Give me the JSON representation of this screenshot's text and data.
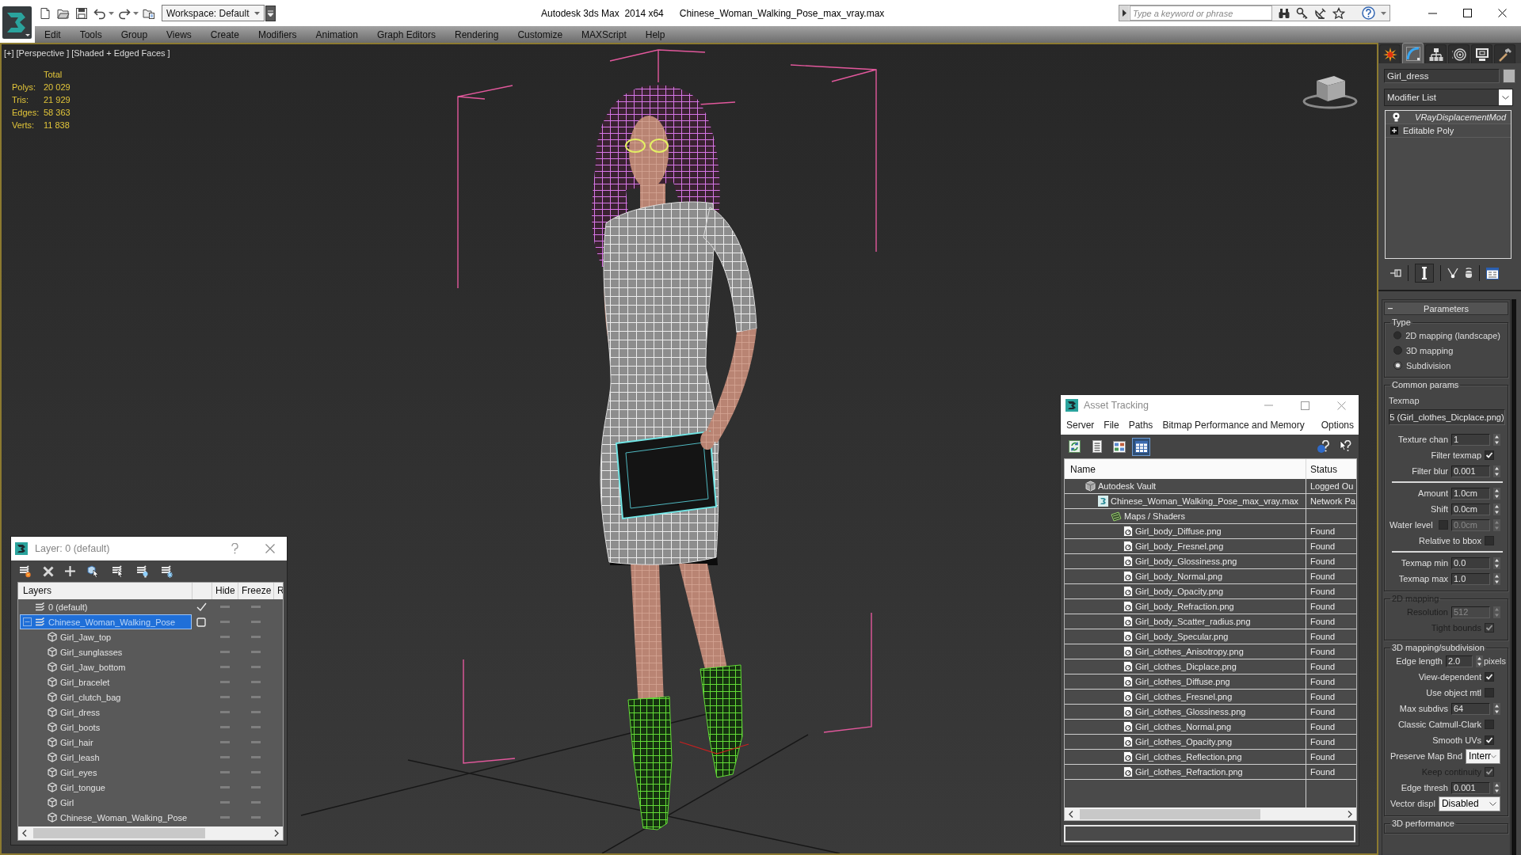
{
  "title_bar": {
    "workspace": "Workspace: Default",
    "app_title": "Autodesk 3ds Max  2014 x64",
    "file_title": "Chinese_Woman_Walking_Pose_max_vray.max",
    "search_placeholder": "Type a keyword or phrase"
  },
  "menu_bar": [
    "Edit",
    "Tools",
    "Group",
    "Views",
    "Create",
    "Modifiers",
    "Animation",
    "Graph Editors",
    "Rendering",
    "Customize",
    "MAXScript",
    "Help"
  ],
  "viewport": {
    "labels": [
      "[+]",
      "[Perspective ]",
      "[Shaded + Edged Faces ]"
    ],
    "stats": {
      "heading": "Total",
      "rows": [
        {
          "label": "Polys:",
          "value": "20 029"
        },
        {
          "label": "Tris:",
          "value": "21 929"
        },
        {
          "label": "Edges:",
          "value": "58 363"
        },
        {
          "label": "Verts:",
          "value": "11 838"
        }
      ]
    }
  },
  "layer_window": {
    "title": "Layer: 0 (default)",
    "columns": [
      "Layers",
      "Hide",
      "Freeze",
      "R"
    ],
    "layers": [
      {
        "name": "0 (default)",
        "current": true,
        "selected": false
      },
      {
        "name": "Chinese_Woman_Walking_Pose",
        "current": false,
        "selected": true,
        "expanded": true,
        "children": [
          {
            "name": "Girl_Jaw_top",
            "selected": false
          },
          {
            "name": "Girl_sunglasses",
            "selected": false
          },
          {
            "name": "Girl_Jaw_bottom",
            "selected": false
          },
          {
            "name": "Girl_bracelet",
            "selected": false
          },
          {
            "name": "Girl_clutch_bag",
            "selected": false
          },
          {
            "name": "Girl_dress",
            "selected": false
          },
          {
            "name": "Girl_boots",
            "selected": false
          },
          {
            "name": "Girl_hair",
            "selected": false
          },
          {
            "name": "Girl_leash",
            "selected": false
          },
          {
            "name": "Girl_eyes",
            "selected": false
          },
          {
            "name": "Girl_tongue",
            "selected": false
          },
          {
            "name": "Girl",
            "selected": false
          },
          {
            "name": "Chinese_Woman_Walking_Pose",
            "selected": false
          }
        ]
      }
    ]
  },
  "asset_tracking": {
    "title": "Asset Tracking",
    "menu": [
      "Server",
      "File",
      "Paths",
      "Bitmap Performance and Memory",
      "Options"
    ],
    "toolbar": [
      {
        "kind": "refresh",
        "selected": false
      },
      {
        "kind": "list",
        "selected": false
      },
      {
        "kind": "thumbnails",
        "selected": false
      },
      {
        "kind": "table",
        "selected": true
      }
    ],
    "columns": [
      "Name",
      "Status"
    ],
    "tree": [
      {
        "kind": "vault",
        "name": "Autodesk Vault",
        "status": "Logged Ou",
        "children": [
          {
            "kind": "scene",
            "name": "Chinese_Woman_Walking_Pose_max_vray.max",
            "status": "Network Pa",
            "children": [
              {
                "kind": "folder",
                "name": "Maps / Shaders",
                "children": [
                  {
                    "kind": "bitmap",
                    "name": "Girl_body_Diffuse.png",
                    "status": "Found"
                  },
                  {
                    "kind": "bitmap",
                    "name": "Girl_body_Fresnel.png",
                    "status": "Found"
                  },
                  {
                    "kind": "bitmap",
                    "name": "Girl_body_Glossiness.png",
                    "status": "Found"
                  },
                  {
                    "kind": "bitmap",
                    "name": "Girl_body_Normal.png",
                    "status": "Found"
                  },
                  {
                    "kind": "bitmap",
                    "name": "Girl_body_Opacity.png",
                    "status": "Found"
                  },
                  {
                    "kind": "bitmap",
                    "name": "Girl_body_Refraction.png",
                    "status": "Found"
                  },
                  {
                    "kind": "bitmap",
                    "name": "Girl_body_Scatter_radius.png",
                    "status": "Found"
                  },
                  {
                    "kind": "bitmap",
                    "name": "Girl_body_Specular.png",
                    "status": "Found"
                  },
                  {
                    "kind": "bitmap",
                    "name": "Girl_clothes_Anisotropy.png",
                    "status": "Found"
                  },
                  {
                    "kind": "bitmap",
                    "name": "Girl_clothes_Dicplace.png",
                    "status": "Found"
                  },
                  {
                    "kind": "bitmap",
                    "name": "Girl_clothes_Diffuse.png",
                    "status": "Found"
                  },
                  {
                    "kind": "bitmap",
                    "name": "Girl_clothes_Fresnel.png",
                    "status": "Found"
                  },
                  {
                    "kind": "bitmap",
                    "name": "Girl_clothes_Glossiness.png",
                    "status": "Found"
                  },
                  {
                    "kind": "bitmap",
                    "name": "Girl_clothes_Normal.png",
                    "status": "Found"
                  },
                  {
                    "kind": "bitmap",
                    "name": "Girl_clothes_Opacity.png",
                    "status": "Found"
                  },
                  {
                    "kind": "bitmap",
                    "name": "Girl_clothes_Reflection.png",
                    "status": "Found"
                  },
                  {
                    "kind": "bitmap",
                    "name": "Girl_clothes_Refraction.png",
                    "status": "Found"
                  }
                ]
              }
            ]
          }
        ]
      }
    ]
  },
  "command_panel": {
    "tabs": [
      {
        "kind": "create",
        "selected": false
      },
      {
        "kind": "modify",
        "selected": true
      },
      {
        "kind": "hierarchy",
        "selected": false
      },
      {
        "kind": "motion",
        "selected": false
      },
      {
        "kind": "display",
        "selected": false
      },
      {
        "kind": "utilities",
        "selected": false
      }
    ],
    "object_name": "Girl_dress",
    "modifier_list": "Modifier List",
    "stack": [
      {
        "kind": "modifier",
        "name": "VRayDisplacementMod"
      },
      {
        "kind": "base",
        "name": "Editable Poly"
      }
    ],
    "rollout": {
      "title": "Parameters",
      "groups": [
        {
          "title": "Type",
          "disabled": false,
          "rows": [
            {
              "kind": "radio",
              "label": "2D mapping (landscape)",
              "selected": false
            },
            {
              "kind": "radio",
              "label": "3D mapping",
              "selected": false
            },
            {
              "kind": "radio",
              "label": "Subdivision",
              "selected": true
            }
          ]
        },
        {
          "title": "Common params",
          "disabled": false,
          "rows": [
            {
              "kind": "label",
              "label": "Texmap"
            },
            {
              "kind": "map_button",
              "value": "5 (Girl_clothes_Dicplace.png)"
            },
            {
              "kind": "spinner",
              "label": "Texture chan",
              "value": "1",
              "disabled": false
            },
            {
              "kind": "checkbox",
              "label": "Filter texmap",
              "checked": true,
              "disabled": false
            },
            {
              "kind": "spinner",
              "label": "Filter blur",
              "value": "0.001",
              "disabled": false
            },
            {
              "kind": "separator"
            },
            {
              "kind": "spinner",
              "label": "Amount",
              "value": "1.0cm",
              "disabled": false
            },
            {
              "kind": "spinner",
              "label": "Shift",
              "value": "0.0cm",
              "disabled": false
            },
            {
              "kind": "check_spinner",
              "label": "Water level",
              "checked": false,
              "value": "0.0cm",
              "disabled": true
            },
            {
              "kind": "checkbox",
              "label": "Relative to bbox",
              "checked": false,
              "disabled": false
            },
            {
              "kind": "separator"
            },
            {
              "kind": "spinner",
              "label": "Texmap min",
              "value": "0.0",
              "disabled": false
            },
            {
              "kind": "spinner",
              "label": "Texmap max",
              "value": "1.0",
              "disabled": false
            }
          ]
        },
        {
          "title": "2D mapping",
          "disabled": true,
          "rows": [
            {
              "kind": "spinner",
              "label": "Resolution",
              "value": "512",
              "disabled": true
            },
            {
              "kind": "checkbox",
              "label": "Tight bounds",
              "checked": true,
              "disabled": true
            }
          ]
        },
        {
          "title": "3D mapping/subdivision",
          "disabled": false,
          "rows": [
            {
              "kind": "spinner",
              "label": "Edge length",
              "value": "2.0",
              "unit": "pixels",
              "disabled": false
            },
            {
              "kind": "checkbox",
              "label": "View-dependent",
              "checked": true,
              "disabled": false
            },
            {
              "kind": "checkbox",
              "label": "Use object mtl",
              "checked": false,
              "disabled": false
            },
            {
              "kind": "spinner",
              "label": "Max subdivs",
              "value": "64",
              "disabled": false
            },
            {
              "kind": "checkbox",
              "label": "Classic Catmull-Clark",
              "checked": false,
              "disabled": false
            },
            {
              "kind": "checkbox",
              "label": "Smooth UVs",
              "checked": true,
              "disabled": false
            },
            {
              "kind": "dropdown",
              "label": "Preserve Map Bnd",
              "value": "Interr",
              "disabled": false
            },
            {
              "kind": "checkbox",
              "label": "Keep continuity",
              "checked": true,
              "disabled": true
            },
            {
              "kind": "spinner",
              "label": "Edge thresh",
              "value": "0.001",
              "disabled": false
            },
            {
              "kind": "dropdown",
              "label": "Vector displ",
              "value": "Disabled",
              "disabled": false
            }
          ]
        },
        {
          "title": "3D performance",
          "disabled": false
        }
      ]
    }
  }
}
